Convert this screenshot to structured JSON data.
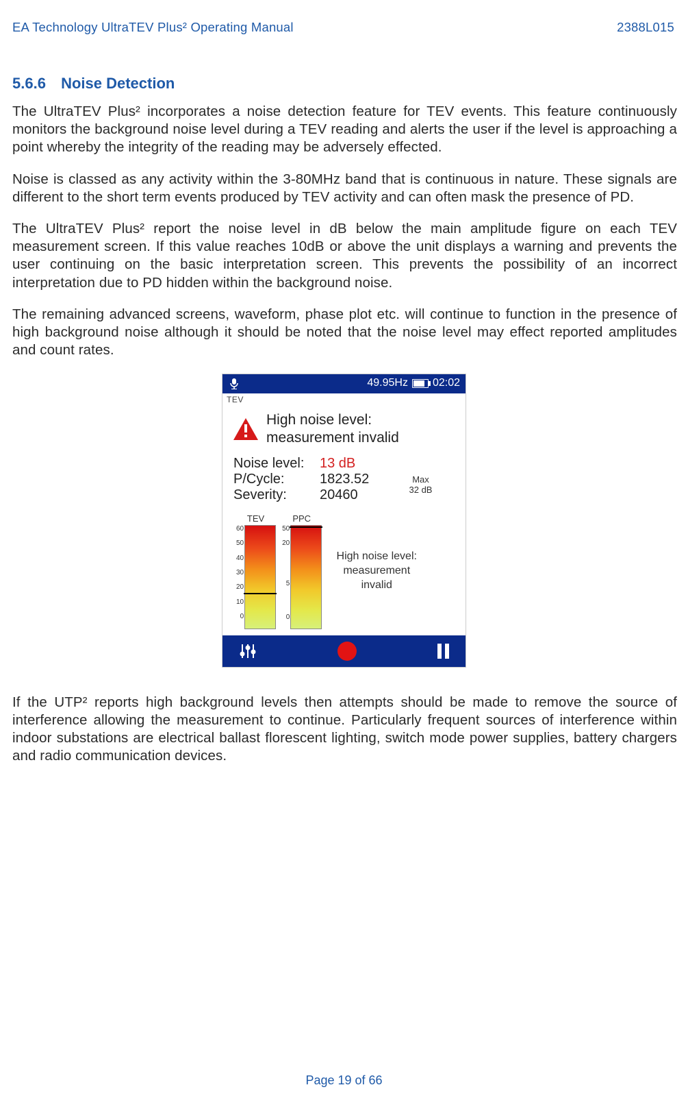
{
  "header": {
    "left": "EA Technology UltraTEV Plus² Operating Manual",
    "right": "2388L015"
  },
  "section": {
    "number": "5.6.6",
    "title": "Noise Detection"
  },
  "paragraphs": {
    "p1": "The UltraTEV Plus² incorporates a noise detection feature for TEV events. This feature continuously monitors the background noise level during a TEV reading and alerts the user if the level is approaching a point whereby the integrity of the reading may be adversely effected.",
    "p2": "Noise is classed as any activity within the 3-80MHz band that is continuous in nature. These signals are different to the short term events produced by TEV activity and can often mask the presence of PD.",
    "p3": "The UltraTEV Plus² report the noise level in dB below the main amplitude figure on each TEV measurement screen. If this value reaches 10dB or above the unit displays a warning and prevents the user continuing on the basic interpretation screen. This prevents the possibility of an incorrect interpretation due to PD hidden within the background noise.",
    "p4": "The remaining advanced screens, waveform, phase plot etc. will continue to function in the presence of high background noise although it should be noted that the noise level may effect reported amplitudes and count rates.",
    "p5": "If the UTP² reports high background levels then attempts should be made to remove the source of interference allowing the measurement to continue. Particularly frequent sources of interference within indoor substations are electrical ballast florescent lighting, switch mode power supplies, battery chargers and radio communication devices."
  },
  "device": {
    "status_bar": {
      "frequency": "49.95Hz",
      "time": "02:02"
    },
    "tab": "TEV",
    "warning": {
      "line1": "High noise level:",
      "line2": "measurement invalid"
    },
    "readings": {
      "noise_label": "Noise level:",
      "noise_value": "13 dB",
      "pcycle_label": "P/Cycle:",
      "pcycle_value": "1823.52",
      "severity_label": "Severity:",
      "severity_value": "20460",
      "max_label": "Max",
      "max_value": "32 dB"
    },
    "bars": {
      "tev": {
        "title": "TEV",
        "ticks": [
          "60",
          "50",
          "40",
          "30",
          "20",
          "10",
          "0"
        ],
        "marker_value": 20,
        "max": 60
      },
      "ppc": {
        "title": "PPC",
        "ticks": [
          "50",
          "20",
          "5",
          "0"
        ],
        "marker_value": 50,
        "max": 50
      }
    },
    "noise_msg": {
      "line1": "High noise level:",
      "line2": "measurement",
      "line3": "invalid"
    },
    "icons": {
      "mic": "mic-icon",
      "battery": "battery-icon",
      "warning": "warning-triangle-icon",
      "sliders": "sliders-icon",
      "record": "record-icon",
      "pause": "pause-icon"
    },
    "colors": {
      "header_blue": "#1f5aa8",
      "device_blue": "#0b2b8a",
      "noise_red": "#d32020",
      "record_red": "#e21313"
    }
  },
  "footer": {
    "page": "Page 19 of 66"
  }
}
